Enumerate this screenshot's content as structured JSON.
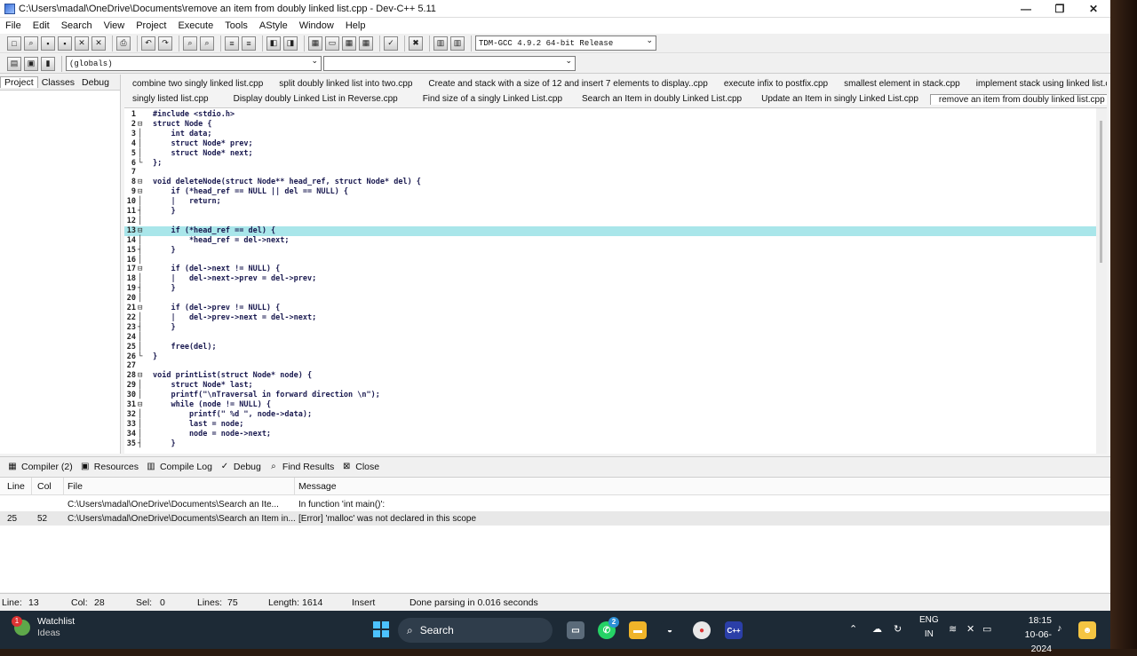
{
  "window": {
    "title": "C:\\Users\\madal\\OneDrive\\Documents\\remove an item from doubly linked list.cpp - Dev-C++ 5.11"
  },
  "menu": [
    "File",
    "Edit",
    "Search",
    "View",
    "Project",
    "Execute",
    "Tools",
    "AStyle",
    "Window",
    "Help"
  ],
  "toolbar": {
    "compiler": "TDM-GCC 4.9.2 64-bit Release",
    "scope": "(globals)",
    "member": ""
  },
  "left_panel": {
    "tabs": [
      "Project",
      "Classes",
      "Debug"
    ]
  },
  "file_tabs_row1": [
    "combine two singly linked list.cpp",
    "split doubly linked list into two.cpp",
    "Create and stack with a size of 12 and insert 7 elements to display..cpp",
    "execute infix to postfix.cpp",
    "smallest element in stack.cpp",
    "implement stack using linked list.cpp"
  ],
  "file_tabs_row2": [
    "singly listed list.cpp",
    "Display doubly Linked List in Reverse.cpp",
    "Find size of a singly Linked List.cpp",
    "Search an Item in doubly Linked List.cpp",
    "Update an Item in singly Linked List.cpp",
    "remove an item from doubly linked list.cpp"
  ],
  "code": [
    {
      "n": "1",
      "fold": "",
      "text": "#include <stdio.h>"
    },
    {
      "n": "2",
      "fold": "⊟",
      "text": "struct Node {"
    },
    {
      "n": "3",
      "fold": "│",
      "text": "    int data;"
    },
    {
      "n": "4",
      "fold": "│",
      "text": "    struct Node* prev;"
    },
    {
      "n": "5",
      "fold": "│",
      "text": "    struct Node* next;"
    },
    {
      "n": "6",
      "fold": "└",
      "text": "};"
    },
    {
      "n": "7",
      "fold": "",
      "text": ""
    },
    {
      "n": "8",
      "fold": "⊟",
      "text": "void deleteNode(struct Node** head_ref, struct Node* del) {"
    },
    {
      "n": "9",
      "fold": "⊟",
      "text": "    if (*head_ref == NULL || del == NULL) {"
    },
    {
      "n": "10",
      "fold": "│",
      "text": "    |   return;"
    },
    {
      "n": "11",
      "fold": "┤",
      "text": "    }"
    },
    {
      "n": "12",
      "fold": "│",
      "text": ""
    },
    {
      "n": "13",
      "fold": "⊟",
      "text": "    if (*head_ref == del) {"
    },
    {
      "n": "14",
      "fold": "│",
      "text": "        *head_ref = del->next;"
    },
    {
      "n": "15",
      "fold": "┤",
      "text": "    }"
    },
    {
      "n": "16",
      "fold": "│",
      "text": ""
    },
    {
      "n": "17",
      "fold": "⊟",
      "text": "    if (del->next != NULL) {"
    },
    {
      "n": "18",
      "fold": "│",
      "text": "    |   del->next->prev = del->prev;"
    },
    {
      "n": "19",
      "fold": "┤",
      "text": "    }"
    },
    {
      "n": "20",
      "fold": "│",
      "text": ""
    },
    {
      "n": "21",
      "fold": "⊟",
      "text": "    if (del->prev != NULL) {"
    },
    {
      "n": "22",
      "fold": "│",
      "text": "    |   del->prev->next = del->next;"
    },
    {
      "n": "23",
      "fold": "┤",
      "text": "    }"
    },
    {
      "n": "24",
      "fold": "│",
      "text": ""
    },
    {
      "n": "25",
      "fold": "│",
      "text": "    free(del);"
    },
    {
      "n": "26",
      "fold": "└",
      "text": "}"
    },
    {
      "n": "27",
      "fold": "",
      "text": ""
    },
    {
      "n": "28",
      "fold": "⊟",
      "text": "void printList(struct Node* node) {"
    },
    {
      "n": "29",
      "fold": "│",
      "text": "    struct Node* last;"
    },
    {
      "n": "30",
      "fold": "│",
      "text": "    printf(\"\\nTraversal in forward direction \\n\");"
    },
    {
      "n": "31",
      "fold": "⊟",
      "text": "    while (node != NULL) {"
    },
    {
      "n": "32",
      "fold": "│",
      "text": "        printf(\" %d \", node->data);"
    },
    {
      "n": "33",
      "fold": "│",
      "text": "        last = node;"
    },
    {
      "n": "34",
      "fold": "│",
      "text": "        node = node->next;"
    },
    {
      "n": "35",
      "fold": "┤",
      "text": "    }"
    }
  ],
  "highlight_line": "13",
  "bottom_tabs": [
    "Compiler (2)",
    "Resources",
    "Compile Log",
    "Debug",
    "Find Results",
    "Close"
  ],
  "messages": {
    "headers": [
      "Line",
      "Col",
      "File",
      "Message"
    ],
    "rows": [
      {
        "line": "",
        "col": "",
        "file": "C:\\Users\\madal\\OneDrive\\Documents\\Search an Ite...",
        "message": "In function 'int main()':"
      },
      {
        "line": "25",
        "col": "52",
        "file": "C:\\Users\\madal\\OneDrive\\Documents\\Search an Item in...",
        "message": "[Error] 'malloc' was not declared in this scope"
      }
    ]
  },
  "status": {
    "line_label": "Line:",
    "line": "13",
    "col_label": "Col:",
    "col": "28",
    "sel_label": "Sel:",
    "sel": "0",
    "lines_label": "Lines:",
    "lines": "75",
    "length_label": "Length:",
    "length": "1614",
    "mode": "Insert",
    "parse": "Done parsing in 0.016 seconds"
  },
  "taskbar": {
    "weather_title": "Watchlist",
    "weather_sub": "Ideas",
    "weather_badge": "1",
    "search": "Search",
    "whatsapp_badge": "2",
    "lang1": "ENG",
    "lang2": "IN",
    "time": "18:15",
    "date": "10-06-2024"
  }
}
